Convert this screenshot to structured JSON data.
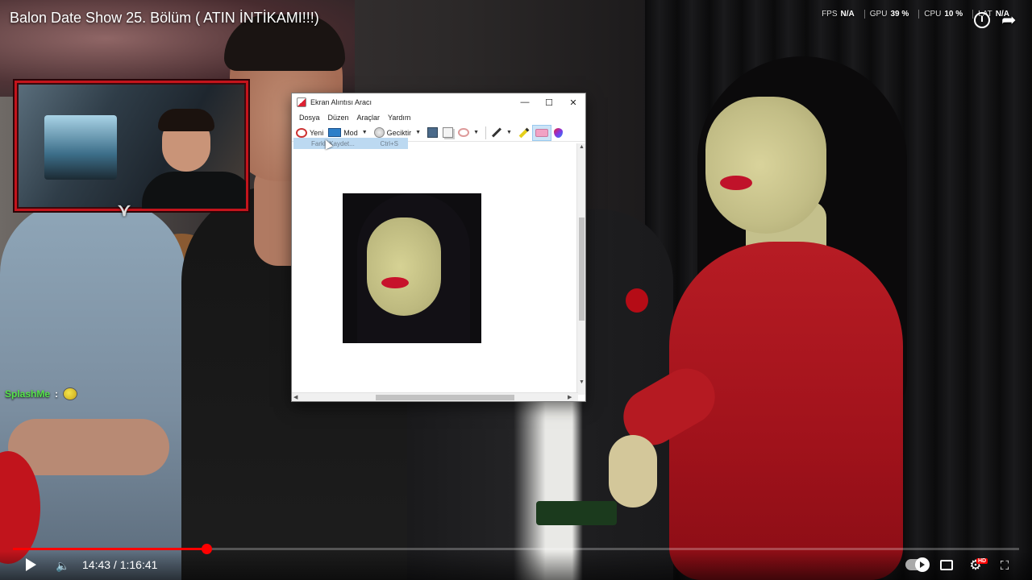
{
  "video": {
    "title": "Balon Date Show 25. Bölüm ( ATIN İNTİKAMI!!!)"
  },
  "perf_overlay": [
    {
      "label": "FPS",
      "value": "N/A"
    },
    {
      "label": "GPU",
      "value": "39 %"
    },
    {
      "label": "CPU",
      "value": "10 %"
    },
    {
      "label": "LAT",
      "value": "N/A"
    }
  ],
  "chat": {
    "username": "SplashMe",
    "separator": ":",
    "emote": "yellow-emote"
  },
  "snipping_tool": {
    "title": "Ekran Alıntısı Aracı",
    "window_buttons": {
      "minimize": "—",
      "maximize": "☐",
      "close": "✕"
    },
    "menu": [
      "Dosya",
      "Düzen",
      "Araçlar",
      "Yardım"
    ],
    "toolbar": {
      "new_label": "Yeni",
      "mode_label": "Mod",
      "delay_label": "Geciktir"
    },
    "dropdown_item": {
      "label": "Farklı Kaydet...",
      "shortcut": "Ctrl+S"
    }
  },
  "player": {
    "current_time": "14:43",
    "duration": "1:16:41",
    "time_separator": " / ",
    "progress_fraction": 0.192,
    "buffer_color": "#ff0000",
    "hd_badge": "HD",
    "icons": [
      "play-icon",
      "volume-icon",
      "autoplay-toggle",
      "subtitles-icon",
      "settings-icon",
      "fullscreen-icon",
      "clock-icon",
      "share-icon"
    ]
  },
  "colors": {
    "accent": "#ff0000",
    "webcam_border": "#c4141c",
    "chat_name": "#56e34b"
  }
}
